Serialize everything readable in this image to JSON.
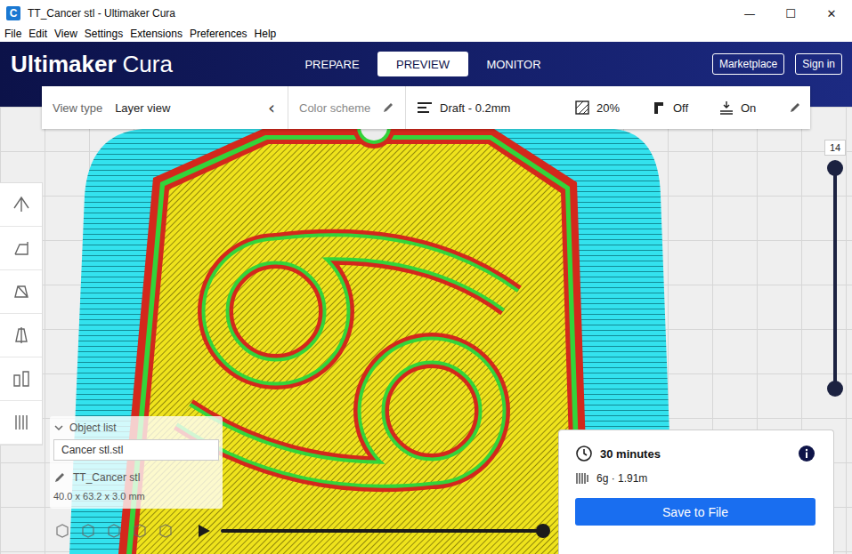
{
  "window": {
    "title": "TT_Cancer stl - Ultimaker Cura",
    "icon": "C",
    "controls": [
      "—",
      "☐",
      "✕"
    ]
  },
  "menu": [
    "File",
    "Edit",
    "View",
    "Settings",
    "Extensions",
    "Preferences",
    "Help"
  ],
  "logo": {
    "brand": "Ultimaker",
    "product": "Cura"
  },
  "stages": [
    {
      "label": "PREPARE",
      "selected": false
    },
    {
      "label": "PREVIEW",
      "selected": true
    },
    {
      "label": "MONITOR",
      "selected": false
    }
  ],
  "header_buttons": [
    "Marketplace",
    "Sign in"
  ],
  "toolbar": {
    "view_type_label": "View type",
    "view_type": "Layer view",
    "collapse_icon": "‹",
    "color_scheme_label": "Color scheme",
    "profile": "Draft - 0.2mm",
    "infill": "20%",
    "support": "Off",
    "adhesion": "On"
  },
  "layer_slider": {
    "label": "14",
    "upper_level": 1,
    "lower_level": 0
  },
  "object_list": {
    "header": "Object list",
    "expanded": true,
    "items": [
      {
        "label": "Cancer stl.stl",
        "selected": false
      }
    ],
    "object_name": "TT_Cancer stl",
    "dimensions": "40.0 x 63.2 x 3.0 mm"
  },
  "playback": {
    "playing": false,
    "level": 1
  },
  "print_info": {
    "time": "30 minutes",
    "material": "6g · 1.91m",
    "button": "Save to File"
  }
}
